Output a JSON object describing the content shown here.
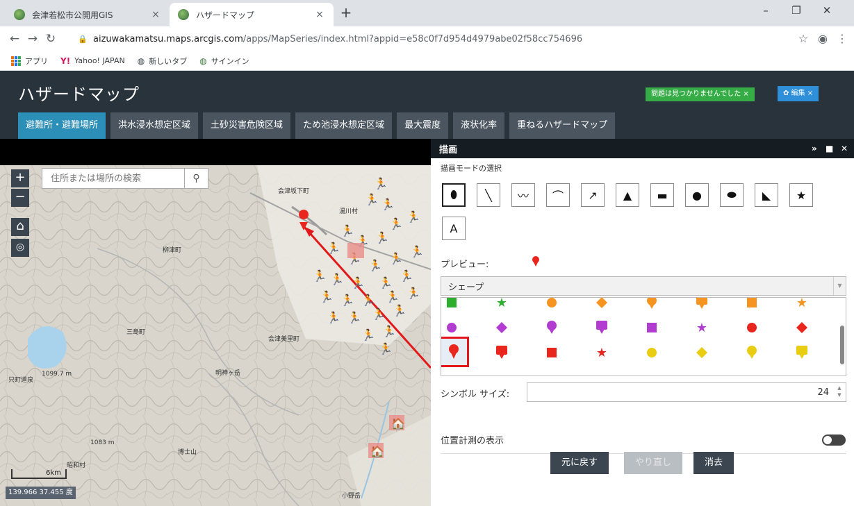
{
  "browser": {
    "tabs": [
      {
        "title": "会津若松市公開用GIS",
        "active": false
      },
      {
        "title": "ハザードマップ",
        "active": true
      }
    ],
    "url_host": "aizuwakamatsu.maps.arcgis.com",
    "url_path": "/apps/MapSeries/index.html?appid=e58c0f7d954d4979abe02f58cc754696",
    "bookmarks": [
      "アプリ",
      "Yahoo! JAPAN",
      "新しいタブ",
      "サインイン"
    ]
  },
  "app": {
    "title": "ハザードマップ",
    "status_badge": "問題は見つかりませんでした ×",
    "edit_badge": "✿ 編集 ×",
    "tabs": [
      "避難所・避難場所",
      "洪水浸水想定区域",
      "土砂災害危険区域",
      "ため池浸水想定区域",
      "最大震度",
      "液状化率",
      "重ねるハザードマップ"
    ],
    "active_tab_index": 0
  },
  "map": {
    "search_placeholder": "住所または場所の検索",
    "coordinates": "139.966 37.455 度",
    "scale_label": "6km",
    "place_labels": [
      "会津坂下町",
      "湯川村",
      "柳津町",
      "会津美里町",
      "三島町",
      "明神ヶ岳",
      "1099.7 m",
      "只町道泉",
      "1083 m",
      "博士山",
      "昭和村",
      "小野岳"
    ]
  },
  "draw_panel": {
    "title": "描画",
    "mode_label": "描画モードの選択",
    "tools": [
      "point",
      "line",
      "polyline",
      "freehand-line",
      "arrow",
      "triangle",
      "rectangle",
      "circle",
      "ellipse",
      "polygon",
      "freehand-polygon",
      "text"
    ],
    "text_tool_label": "A",
    "preview_label": "プレビュー:",
    "shape_select_value": "シェープ",
    "symbol_colors": {
      "green": "#2eae2e",
      "orange": "#f59420",
      "purple": "#b23bd0",
      "red": "#e8261e",
      "yellow": "#e9cd12"
    },
    "symbol_size_label": "シンボル サイズ:",
    "symbol_size": "24",
    "location_label": "位置計測の表示",
    "buttons": {
      "undo": "元に戻す",
      "redo": "やり直し",
      "clear": "消去"
    }
  }
}
